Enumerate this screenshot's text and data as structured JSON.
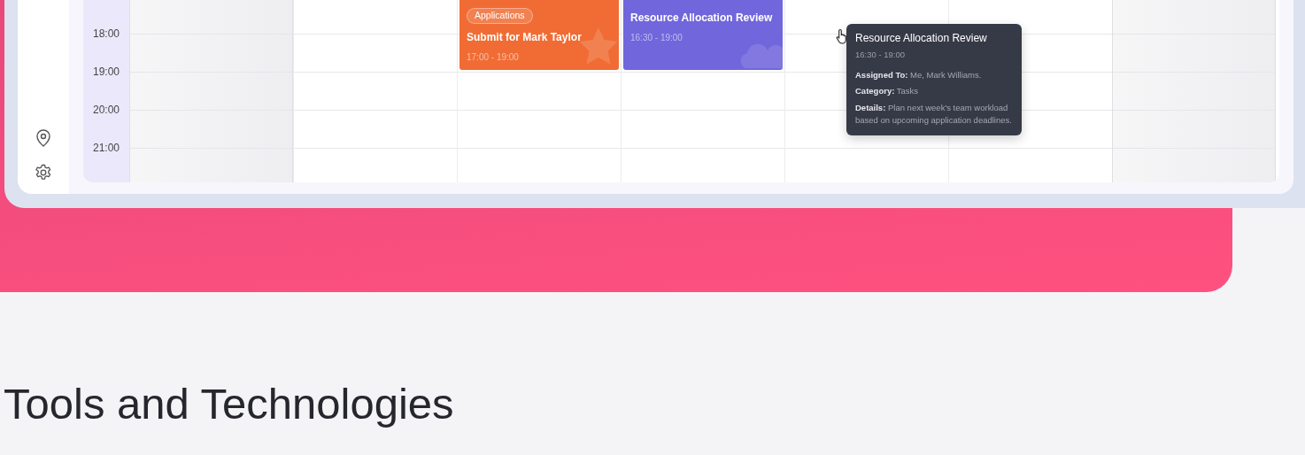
{
  "calendar": {
    "times": [
      "18:00",
      "19:00",
      "20:00",
      "21:00"
    ],
    "columns": [
      {
        "weekend": true
      },
      {
        "weekend": false
      },
      {
        "weekend": false,
        "events": [
          {
            "kind": "applications",
            "color": "#f06c34",
            "tag": "Applications",
            "title": "Submit for Mark Taylor",
            "time": "17:00  - 19:00"
          }
        ]
      },
      {
        "weekend": false,
        "events": [
          {
            "kind": "tasks",
            "color": "#7166dc",
            "title": "Resource Allocation Review",
            "time": "16:30 - 19:00"
          }
        ]
      },
      {
        "weekend": false
      },
      {
        "weekend": false
      },
      {
        "weekend": true
      }
    ]
  },
  "tooltip": {
    "title": "Resource Allocation Review",
    "time": "16:30 - 19:00",
    "fields": [
      {
        "label": "Assigned To:",
        "value": "Me, Mark Williams."
      },
      {
        "label": "Category:",
        "value": "Tasks"
      },
      {
        "label": "Details:",
        "value": "Plan next week's team workload based on upcoming application deadlines."
      }
    ]
  },
  "section": {
    "heading": "Tools and Technologies"
  }
}
